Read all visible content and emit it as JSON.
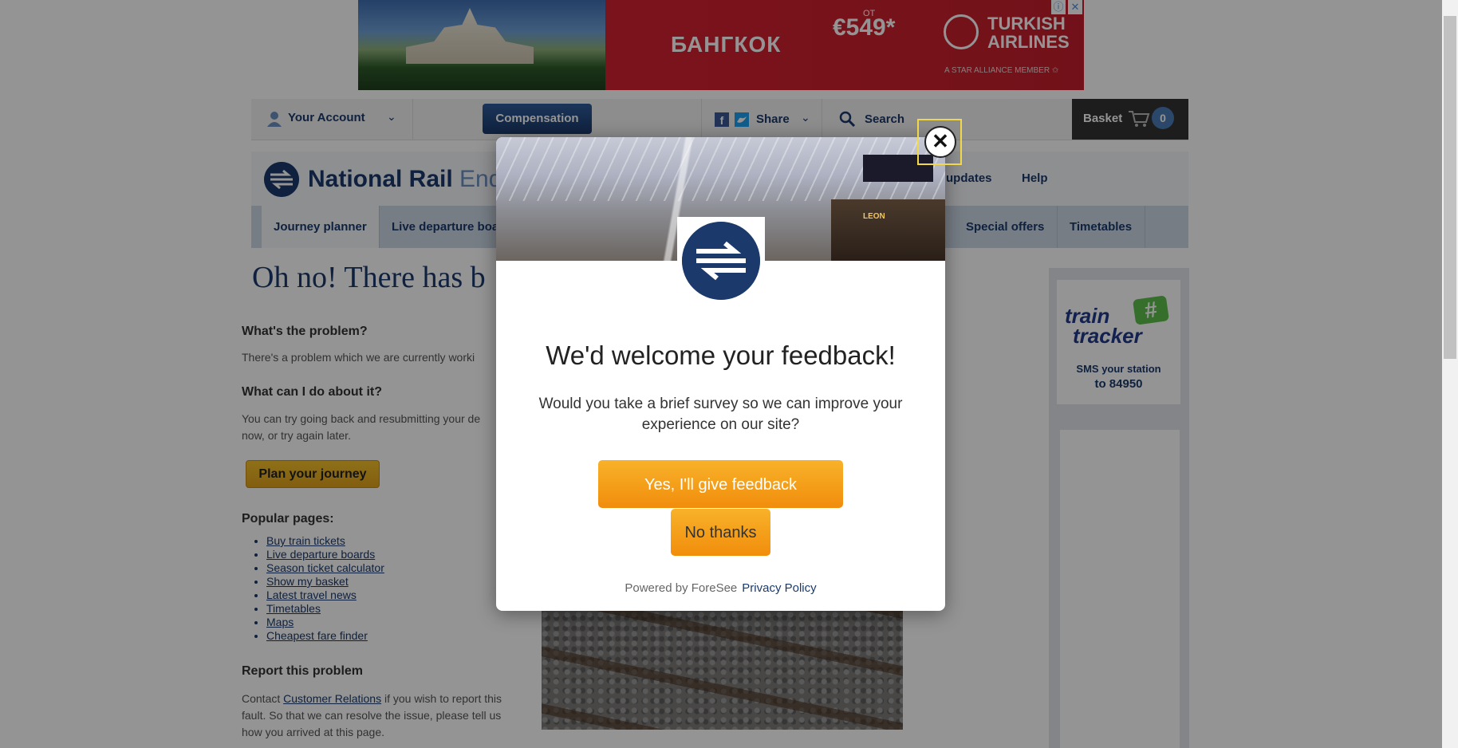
{
  "ad": {
    "city": "БАНГКОК",
    "price_prefix": "ОТ",
    "price": "€549*",
    "airline": "TURKISH\nAIRLINES",
    "airline_line1": "TURKISH",
    "airline_line2": "AIRLINES",
    "alliance": "A STAR ALLIANCE MEMBER ✩",
    "info_icon": "ⓘ",
    "close_icon": "✕"
  },
  "topbar": {
    "account_label": "Your Account",
    "compensation_label": "Compensation",
    "share_label": "Share",
    "search_label": "Search",
    "basket_label": "Basket",
    "basket_count": "0",
    "chevron": "⌄"
  },
  "header": {
    "brand_bold": "National Rail ",
    "brand_light": "Enq",
    "util_links": [
      "updates",
      "Help"
    ]
  },
  "nav": {
    "items": [
      "Journey planner",
      "Live departure boa",
      "Special offers",
      "Timetables"
    ],
    "active": "Journey planner"
  },
  "content": {
    "title": "Oh no! There has b",
    "problem_heading": "What's the problem?",
    "problem_text": "There's a problem which we are currently worki",
    "action_heading": "What can I do about it?",
    "action_text_1": "You can try going back and resubmitting your de",
    "action_text_2": "now, or try again later.",
    "plan_button": "Plan your journey",
    "popular_heading": "Popular pages:",
    "popular_links": [
      "Buy train tickets",
      "Live departure boards",
      "Season ticket calculator",
      "Show my basket",
      "Latest travel news",
      "Timetables",
      "Maps",
      "Cheapest fare finder"
    ],
    "report_heading": "Report this problem",
    "report_text_pre": "Contact ",
    "report_link": "Customer Relations",
    "report_text_post": " if you wish to report this",
    "report_text_2": "fault. So that we can resolve the issue, please tell us",
    "report_text_3": "how you arrived at this page."
  },
  "sidebar": {
    "tt_word1": "train",
    "tt_word2": "tracker",
    "tt_hash": "#",
    "tt_sms_1": "SMS your station",
    "tt_sms_2": "to 84950"
  },
  "modal": {
    "shop_sign": "LEON",
    "title": "We'd welcome your feedback!",
    "text": "Would you take a brief survey so we can improve your experience on our site?",
    "yes_button": "Yes, I'll give feedback",
    "no_button": "No thanks",
    "powered_by": "Powered by ForeSee",
    "privacy": "Privacy Policy",
    "close_icon": "✕"
  },
  "colors": {
    "brand_navy": "#1b3a6b",
    "accent_orange": "#f39a14",
    "ad_red": "#d42131"
  }
}
